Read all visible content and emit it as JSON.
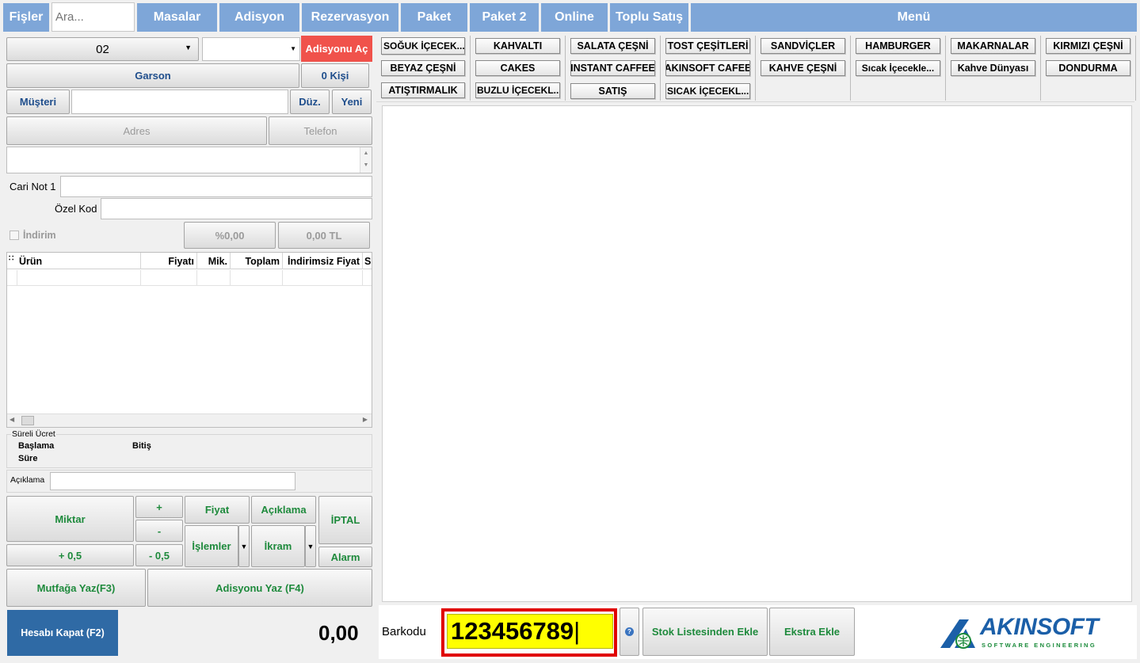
{
  "tabs": {
    "fisler": "Fişler",
    "search_placeholder": "Ara...",
    "masalar": "Masalar",
    "adisyon": "Adisyon",
    "rezervasyon": "Rezervasyon",
    "paket": "Paket",
    "paket2": "Paket 2",
    "online": "Online",
    "toplu_satis": "Toplu Satış",
    "menu": "Menü"
  },
  "left": {
    "table_select": "02",
    "adisyon_ac": "Adisyonu Aç",
    "garson": "Garson",
    "kisi": "0 Kişi",
    "musteri": "Müşteri",
    "duz": "Düz.",
    "yeni": "Yeni",
    "adres": "Adres",
    "telefon": "Telefon",
    "cari_not": "Cari Not 1",
    "ozel_kod": "Özel Kod",
    "indirim": "İndirim",
    "indirim_percent": "%0,00",
    "indirim_tl": "0,00 TL",
    "grid_headers": [
      "Ürün",
      "Fiyatı",
      "Mik.",
      "Toplam",
      "İndirimsiz Fiyat",
      "S"
    ],
    "sureli_ucret": "Süreli Ücret",
    "baslama": "Başlama",
    "bitis": "Bitiş",
    "sure": "Süre",
    "aciklama_label": "Açıklama"
  },
  "actions": {
    "miktar": "Miktar",
    "plus": "+",
    "minus": "-",
    "fiyat": "Fiyat",
    "aciklama": "Açıklama",
    "iptal": "İPTAL",
    "plus_half": "+ 0,5",
    "minus_half": "- 0,5",
    "islemler": "İşlemler",
    "ikram": "İkram",
    "alarm": "Alarm",
    "mutfaga_yaz": "Mutfağa Yaz(F3)",
    "adisyonu_yaz": "Adisyonu Yaz (F4)",
    "hesabi_kapat": "Hesabı Kapat (F2)",
    "total": "0,00"
  },
  "categories": [
    "SOĞUK İÇECEK...",
    "KAHVALTI",
    "SALATA ÇEŞNİ",
    "TOST ÇEŞİTLERİ",
    "SANDVİÇLER",
    "HAMBURGER",
    "MAKARNALAR",
    "KIRMIZI ÇEŞNİ",
    "BEYAZ ÇEŞNİ",
    "CAKES",
    "INSTANT CAFFEE",
    "AKINSOFT CAFEE",
    "KAHVE ÇEŞNİ",
    "Sıcak İçecekle...",
    "Kahve Dünyası",
    "DONDURMA",
    "ATIŞTIRMALIK",
    "BUZLU İÇECEKL...",
    "SATIŞ",
    "SICAK İÇECEKL..."
  ],
  "bottom": {
    "barkodu": "Barkodu",
    "barcode_value": "123456789",
    "stok_listesinden_ekle": "Stok Listesinden Ekle",
    "ekstra_ekle": "Ekstra Ekle",
    "logo_text": "AKINSOFT",
    "logo_sub": "SOFTWARE ENGINEERING"
  },
  "colors": {
    "tab_blue": "#7ea6d8",
    "adisyon_red": "#f0524b",
    "hesap_blue": "#2f6aa5",
    "barcode_yellow": "#ffff00",
    "highlight_red": "#e00000",
    "green_text": "#1e8a3c"
  }
}
